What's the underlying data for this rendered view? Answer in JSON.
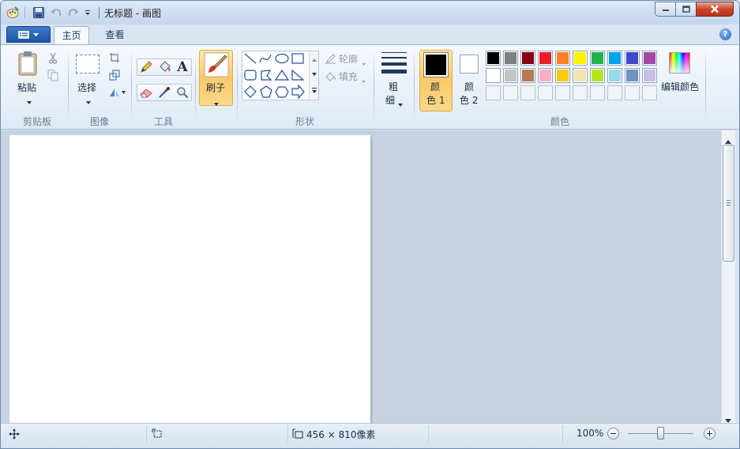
{
  "window": {
    "title": "无标题 - 画图",
    "minimize_icon": "minimize-icon",
    "maximize_icon": "maximize-icon",
    "close_icon": "close-icon"
  },
  "quick_access": {
    "app_icon": "paint-palette-icon",
    "save_icon": "save-icon",
    "undo_icon": "undo-icon",
    "redo_icon": "redo-icon",
    "customize_icon": "dropdown-arrow-icon"
  },
  "tabs": {
    "file_menu_icon": "file-menu-icon",
    "home": "主页",
    "view": "查看",
    "help_icon": "help-icon"
  },
  "ribbon": {
    "clipboard": {
      "paste_label": "粘贴",
      "cut_icon": "scissors-icon",
      "copy_icon": "copy-icon",
      "group_label": "剪贴板"
    },
    "image": {
      "select_label": "选择",
      "crop_icon": "crop-icon",
      "resize_icon": "resize-icon",
      "rotate_icon": "rotate-icon",
      "group_label": "图像"
    },
    "tools": {
      "pencil_icon": "pencil-icon",
      "fill_icon": "fill-bucket-icon",
      "text_icon": "text-icon",
      "text_glyph": "A",
      "eraser_icon": "eraser-icon",
      "picker_icon": "color-picker-icon",
      "magnifier_icon": "magnifier-icon",
      "group_label": "工具"
    },
    "brushes": {
      "label": "刷子"
    },
    "shapes": {
      "outline_label": "轮廓",
      "fill_label": "填充",
      "group_label": "形状",
      "items": [
        "line",
        "curve",
        "oval",
        "rectangle",
        "rounded-rectangle",
        "polygon",
        "triangle",
        "right-triangle",
        "diamond",
        "pentagon",
        "hexagon",
        "right-arrow"
      ]
    },
    "size": {
      "label_line1": "粗",
      "label_line2": "细"
    },
    "colors": {
      "color1_label_line1": "颜",
      "color1_label_line2": "色 1",
      "color1_value": "#000000",
      "color2_label_line1": "颜",
      "color2_label_line2": "色 2",
      "color2_value": "#ffffff",
      "edit_colors_label": "编辑颜色",
      "group_label": "颜色",
      "palette_row1": [
        "#000000",
        "#7f7f7f",
        "#880015",
        "#ed1c24",
        "#ff7f27",
        "#fff200",
        "#22b14c",
        "#00a2e8",
        "#3f48cc",
        "#a349a4"
      ],
      "palette_row2": [
        "#ffffff",
        "#c3c3c3",
        "#b97a57",
        "#ffaec9",
        "#ffc90e",
        "#efe4b0",
        "#b5e61d",
        "#99d9ea",
        "#7092be",
        "#c8bfe7"
      ],
      "palette_row3": [
        "",
        "",
        "",
        "",
        "",
        "",
        "",
        "",
        "",
        ""
      ]
    }
  },
  "statusbar": {
    "cursor_icon": "cursor-position-icon",
    "selection_icon": "selection-size-icon",
    "canvas_size_icon": "canvas-size-icon",
    "canvas_size": "456 × 810像素",
    "zoom": "100%",
    "zoom_out_icon": "zoom-out-icon",
    "zoom_in_icon": "zoom-in-icon",
    "zoom_level_fraction": 0.5
  }
}
